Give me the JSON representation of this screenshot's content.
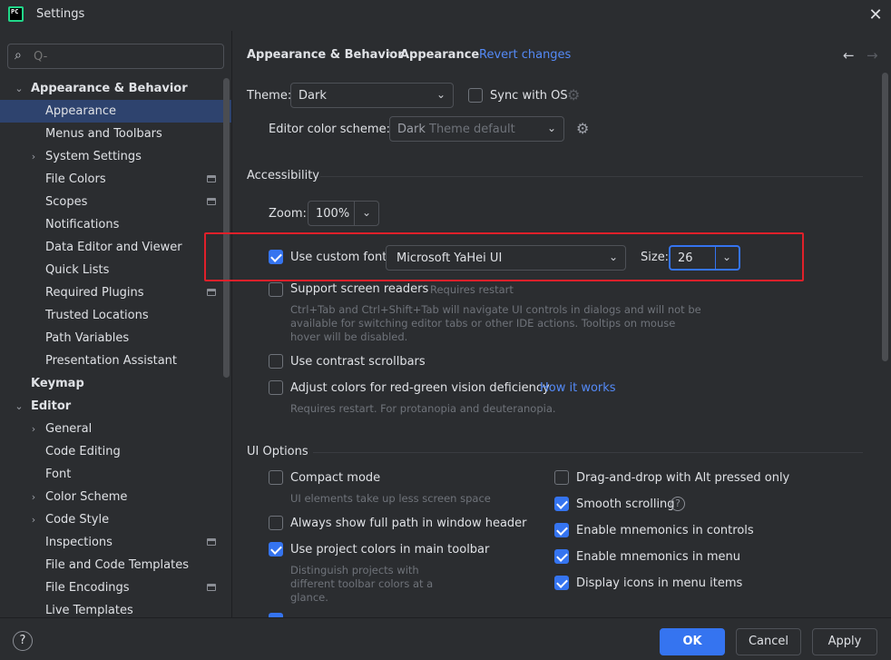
{
  "window": {
    "title": "Settings",
    "logo_text": "PC"
  },
  "search": {
    "placeholder": "Q-",
    "value": ""
  },
  "sidebar": {
    "items": [
      {
        "label": "Appearance & Behavior",
        "arrow": "⌄"
      },
      {
        "label": "Appearance"
      },
      {
        "label": "Menus and Toolbars"
      },
      {
        "label": "System Settings",
        "arrow": "›"
      },
      {
        "label": "File Colors"
      },
      {
        "label": "Scopes"
      },
      {
        "label": "Notifications"
      },
      {
        "label": "Data Editor and Viewer"
      },
      {
        "label": "Quick Lists"
      },
      {
        "label": "Required Plugins"
      },
      {
        "label": "Trusted Locations"
      },
      {
        "label": "Path Variables"
      },
      {
        "label": "Presentation Assistant"
      },
      {
        "label": "Keymap"
      },
      {
        "label": "Editor",
        "arrow": "⌄"
      },
      {
        "label": "General",
        "arrow": "›"
      },
      {
        "label": "Code Editing"
      },
      {
        "label": "Font"
      },
      {
        "label": "Color Scheme",
        "arrow": "›"
      },
      {
        "label": "Code Style",
        "arrow": "›"
      },
      {
        "label": "Inspections"
      },
      {
        "label": "File and Code Templates"
      },
      {
        "label": "File Encodings"
      },
      {
        "label": "Live Templates"
      }
    ]
  },
  "header": {
    "breadcrumb_parent": "Appearance & Behavior",
    "breadcrumb_sep": "›",
    "breadcrumb_current": "Appearance",
    "revert": "Revert changes",
    "back": "←",
    "forward": "→"
  },
  "theme": {
    "label": "Theme:",
    "value": "Dark",
    "sync_label": "Sync with OS",
    "sync_checked": false
  },
  "scheme": {
    "label": "Editor color scheme:",
    "value_primary": "Dark",
    "value_secondary": "Theme default"
  },
  "accessibility": {
    "section_title": "Accessibility",
    "zoom_label": "Zoom:",
    "zoom_value": "100%",
    "custom_font_label": "Use custom font:",
    "custom_font_checked": true,
    "font_value": "Microsoft YaHei UI",
    "size_label": "Size:",
    "size_value": "26",
    "screen_readers_label": "Support screen readers",
    "screen_readers_note": "Requires restart",
    "screen_readers_desc_1": "Ctrl+Tab and Ctrl+Shift+Tab will navigate UI controls in dialogs and will not be",
    "screen_readers_desc_2": "available for switching editor tabs or other IDE actions. Tooltips on mouse",
    "screen_readers_desc_3": "hover will be disabled.",
    "contrast_label": "Use contrast scrollbars",
    "adjust_label": "Adjust colors for red-green vision deficiency",
    "how_it_works": "How it works",
    "adjust_desc": "Requires restart. For protanopia and deuteranopia."
  },
  "ui_options": {
    "section_title": "UI Options",
    "compact_label": "Compact mode",
    "compact_desc": "UI elements take up less screen space",
    "full_path_label": "Always show full path in window header",
    "project_colors_label": "Use project colors in main toolbar",
    "project_colors_desc_1": "Distinguish projects with",
    "project_colors_desc_2": "different toolbar colors at a",
    "project_colors_desc_3": "glance.",
    "dnd_label": "Drag-and-drop with Alt pressed only",
    "smooth_label": "Smooth scrolling",
    "mnemonics_controls_label": "Enable mnemonics in controls",
    "mnemonics_menu_label": "Enable mnemonics in menu",
    "display_icons_label": "Display icons in menu items"
  },
  "footer": {
    "help": "?",
    "ok": "OK",
    "cancel": "Cancel",
    "apply": "Apply"
  },
  "colors": {
    "accent": "#3574f0",
    "link": "#548af7",
    "selection": "#2e436e",
    "highlight": "#e0202a"
  }
}
